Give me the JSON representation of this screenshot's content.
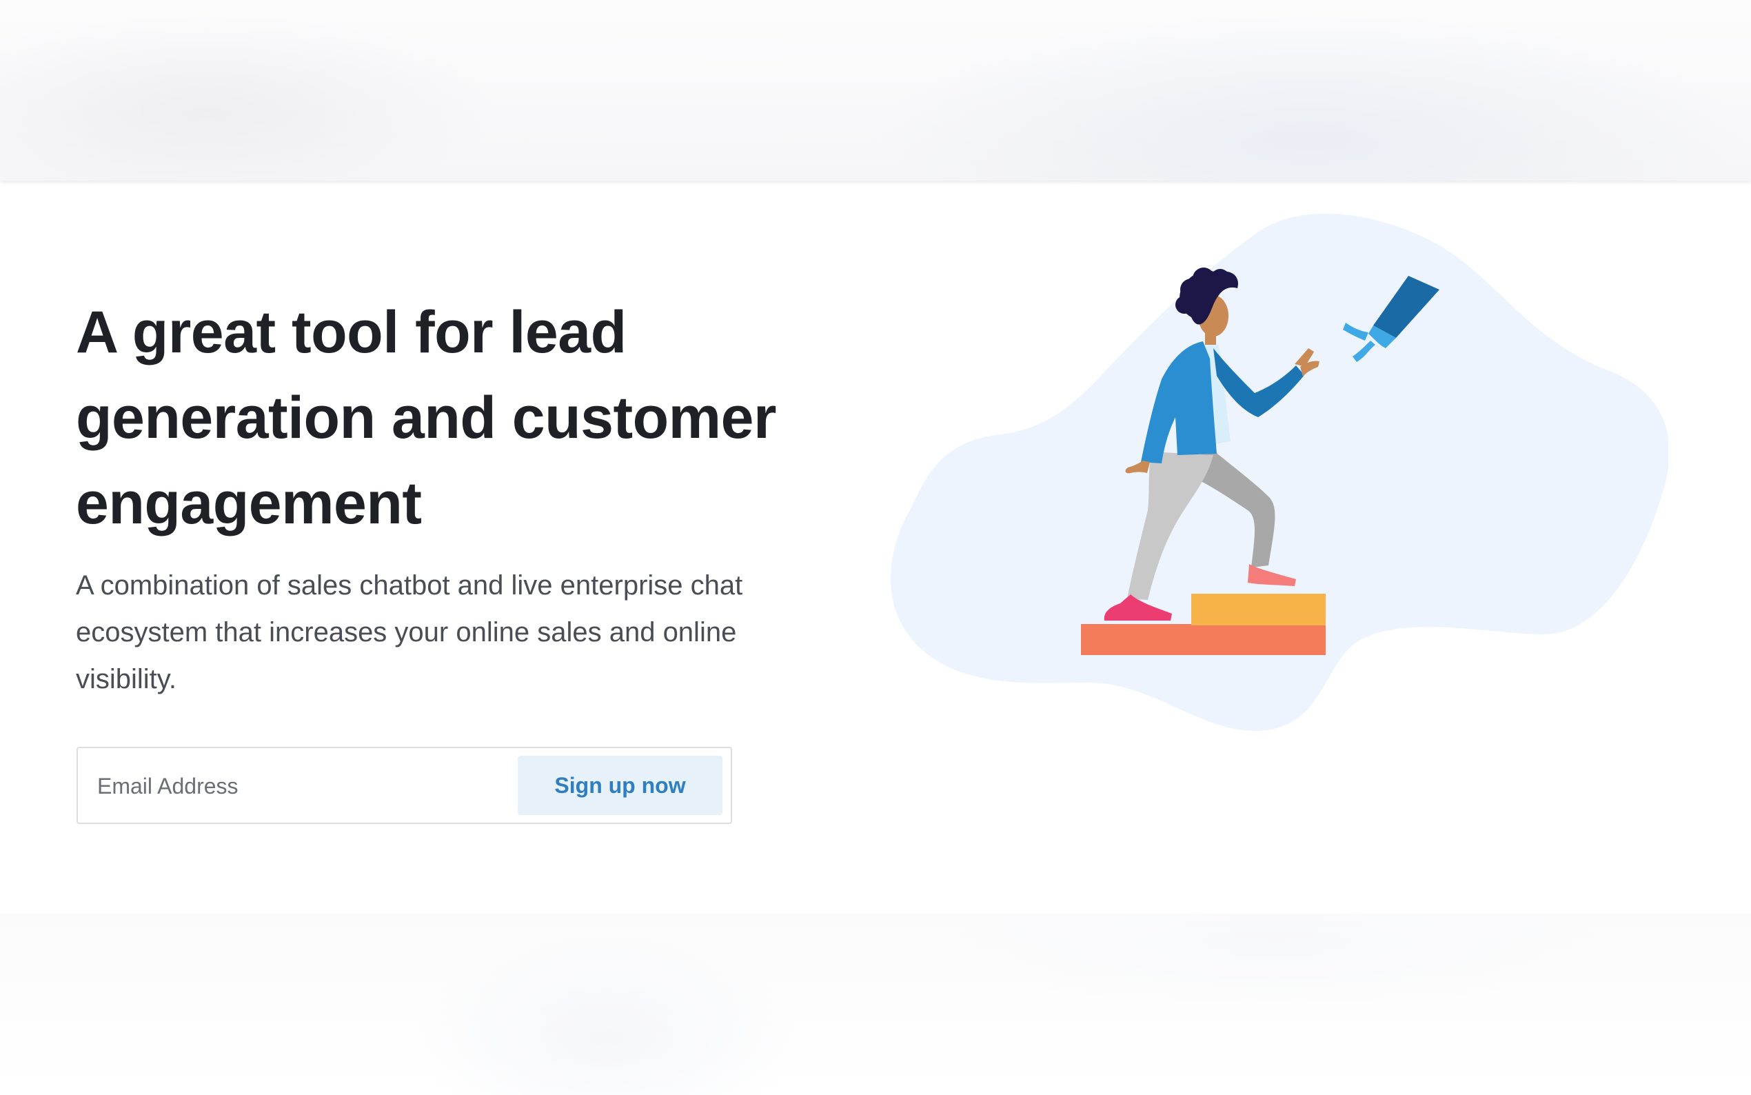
{
  "hero": {
    "title_lines": [
      "A great tool for lead",
      "generation and customer",
      "engagement"
    ],
    "subtitle_lines": [
      "A combination of sales chatbot and live enterprise chat",
      "ecosystem that increases your online sales and online",
      "visibility."
    ]
  },
  "signup": {
    "email_placeholder": "Email Address",
    "button_label": "Sign up now"
  },
  "illustration": {
    "icon": "person-climbing-steps-robot-hand",
    "colors": {
      "blob": "#eef4fd",
      "jacket": "#2a8ed0",
      "pants": "#c4c4c4",
      "step_top": "#f7b24a",
      "step_bottom": "#f47c5a",
      "robot_arm": "#1a6aa6",
      "robot_hand": "#3fa9e8"
    }
  },
  "colors": {
    "title": "#1f2126",
    "subtitle": "#4a4d54",
    "button_bg": "#e6f1fa",
    "button_text": "#2f7fc0"
  }
}
